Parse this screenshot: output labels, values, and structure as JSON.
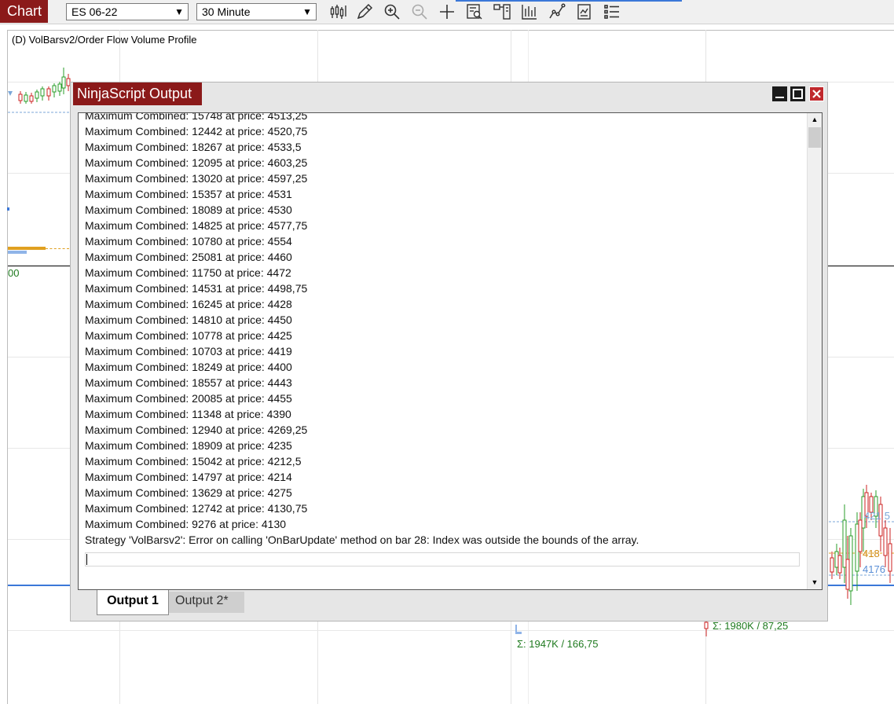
{
  "toolbar": {
    "chart_tab_label": "Chart",
    "instrument": "ES 06-22",
    "interval": "30 Minute",
    "icons": [
      "bar-type-icon",
      "drawing-tool-icon",
      "zoom-in-icon",
      "zoom-out-icon",
      "crosshair-icon",
      "data-box-icon",
      "chart-trader-icon",
      "strategies-icon",
      "indicators-icon",
      "templates-icon",
      "properties-icon"
    ]
  },
  "chart": {
    "title": "(D) VolBarsv2/Order Flow Volume Profile",
    "price_label_left": "00",
    "annotation_mid": "Σ: 1947K / 166,75",
    "annotation_right": "Σ: 1980K / 87,25",
    "price_tag_top": "421",
    "price_tag_top_suffix": "5",
    "price_tag_mid": "418",
    "price_tag_bottom": "4176",
    "colors": {
      "up": "#2a9d2a",
      "down": "#cc2222",
      "profile_orange": "#e0a020",
      "profile_blue": "#8fb4e8",
      "accent_blue": "#3b78d8"
    }
  },
  "output_window": {
    "title": "NinjaScript Output",
    "log_lines": [
      "Maximum Combined: 15748 at price: 4513,25",
      "Maximum Combined: 12442 at price: 4520,75",
      "Maximum Combined: 18267 at price: 4533,5",
      "Maximum Combined: 12095 at price: 4603,25",
      "Maximum Combined: 13020 at price: 4597,25",
      "Maximum Combined: 15357 at price: 4531",
      "Maximum Combined: 18089 at price: 4530",
      "Maximum Combined: 14825 at price: 4577,75",
      "Maximum Combined: 10780 at price: 4554",
      "Maximum Combined: 25081 at price: 4460",
      "Maximum Combined: 11750 at price: 4472",
      "Maximum Combined: 14531 at price: 4498,75",
      "Maximum Combined: 16245 at price: 4428",
      "Maximum Combined: 14810 at price: 4450",
      "Maximum Combined: 10778 at price: 4425",
      "Maximum Combined: 10703 at price: 4419",
      "Maximum Combined: 18249 at price: 4400",
      "Maximum Combined: 18557 at price: 4443",
      "Maximum Combined: 20085 at price: 4455",
      "Maximum Combined: 11348 at price: 4390",
      "Maximum Combined: 12940 at price: 4269,25",
      "Maximum Combined: 18909 at price: 4235",
      "Maximum Combined: 15042 at price: 4212,5",
      "Maximum Combined: 14797 at price: 4214",
      "Maximum Combined: 13629 at price: 4275",
      "Maximum Combined: 12742 at price: 4130,75",
      "Maximum Combined: 9276 at price: 4130",
      "Strategy 'VolBarsv2': Error on calling 'OnBarUpdate' method on bar 28: Index was outside the bounds of the array."
    ],
    "tabs": [
      {
        "label": "Output 1",
        "active": true
      },
      {
        "label": "Output 2*",
        "active": false
      }
    ]
  }
}
